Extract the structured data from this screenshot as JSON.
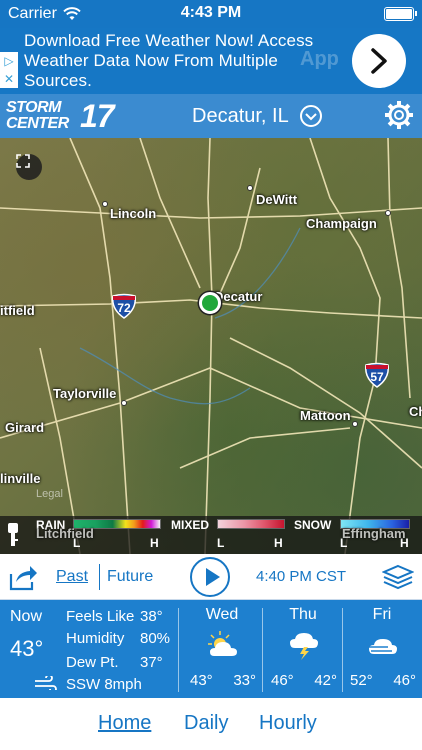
{
  "status_bar": {
    "carrier": "Carrier",
    "time": "4:43 PM"
  },
  "ad": {
    "lines": [
      "Download Free Weather Now! Access",
      "Weather Data Now From Multiple",
      "Sources."
    ],
    "ghost_text": "App",
    "icon": "chevron-right-icon"
  },
  "header": {
    "logo_line1": "STORM",
    "logo_line2": "CENTER",
    "logo_number": "17",
    "location": "Decatur, IL"
  },
  "map": {
    "cities": [
      "Lincoln",
      "DeWitt",
      "Champaign",
      "Decatur",
      "itfield",
      "Taylorville",
      "Mattoon",
      "Girard",
      "linville",
      "Ch",
      "Litchfield",
      "Effingham"
    ],
    "shields": [
      "72",
      "57"
    ],
    "legal": "Legal"
  },
  "legend": {
    "rain_label": "RAIN",
    "mixed_label": "MIXED",
    "snow_label": "SNOW",
    "low": "L",
    "high": "H"
  },
  "toolbar": {
    "past": "Past",
    "future": "Future",
    "timestamp": "4:40 PM CST"
  },
  "current": {
    "now_label": "Now",
    "now_temp": "43°",
    "feels_like_label": "Feels Like",
    "feels_like": "38°",
    "humidity_label": "Humidity",
    "humidity": "80%",
    "dew_point_label": "Dew Pt.",
    "dew_point": "37°",
    "wind": "SSW 8mph"
  },
  "forecast": [
    {
      "day": "Wed",
      "hi": "43°",
      "lo": "33°",
      "icon": "partly-cloudy-icon"
    },
    {
      "day": "Thu",
      "hi": "46°",
      "lo": "42°",
      "icon": "thunderstorm-icon"
    },
    {
      "day": "Fri",
      "hi": "52°",
      "lo": "46°",
      "icon": "windy-icon"
    }
  ],
  "nav": {
    "home": "Home",
    "daily": "Daily",
    "hourly": "Hourly"
  },
  "colors": {
    "brand_blue": "#1676c4",
    "panel_blue": "#1e80cf",
    "gps_green": "#21a83b"
  }
}
